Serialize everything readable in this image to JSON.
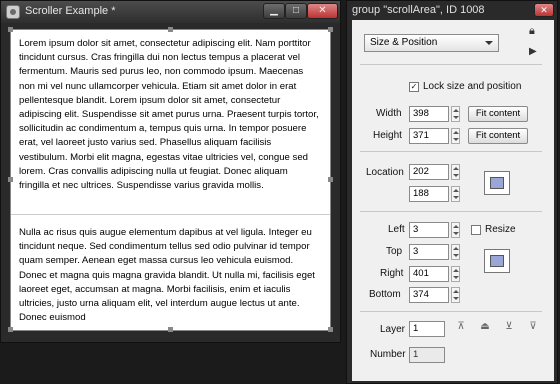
{
  "scroller_window": {
    "title": "Scroller Example *",
    "controls": {
      "minimize": "▁",
      "maximize": "□",
      "close": "✕"
    },
    "paragraph_1": "Lorem ipsum dolor sit amet, consectetur adipiscing elit. Nam porttitor tincidunt cursus. Cras fringilla dui non lectus tempus a placerat vel fermentum. Mauris sed purus leo, non commodo ipsum. Maecenas non mi vel nunc ullamcorper vehicula. Etiam sit amet dolor in erat pellentesque blandit. Lorem ipsum dolor sit amet, consectetur adipiscing elit. Suspendisse sit amet purus urna. Praesent turpis tortor, sollicitudin ac condimentum a, tempus quis urna. In tempor posuere erat, vel laoreet justo varius sed. Phasellus aliquam facilisis vestibulum. Morbi elit magna, egestas vitae ultricies vel, congue sed lorem. Cras convallis adipiscing nulla ut feugiat. Donec aliquam fringilla et nec ultrices. Suspendisse varius gravida mollis.",
    "paragraph_2": "Nulla ac risus quis augue elementum dapibus at vel ligula. Integer eu tincidunt neque. Sed condimentum tellus sed odio pulvinar id tempor quam semper. Aenean eget massa cursus leo vehicula euismod. Donec et magna quis magna gravida blandit. Ut nulla mi, facilisis eget laoreet eget, accumsan at magna. Morbi facilisis, enim et iaculis ultricies, justo urna aliquam elit, vel interdum augue lectus ut ante. Donec euismod"
  },
  "inspector": {
    "title": "group \"scrollArea\", ID 1008",
    "close": "✕",
    "section_select": "Size & Position",
    "lock_checkbox": {
      "label": "Lock size and position",
      "checked": true,
      "mark": "✓"
    },
    "width": {
      "label": "Width",
      "value": "398"
    },
    "height": {
      "label": "Height",
      "value": "371"
    },
    "fit_content_label": "Fit content",
    "location": {
      "label": "Location",
      "x": "202",
      "y": "188"
    },
    "left": {
      "label": "Left",
      "value": "3"
    },
    "top": {
      "label": "Top",
      "value": "3"
    },
    "right": {
      "label": "Right",
      "value": "401"
    },
    "bottom": {
      "label": "Bottom",
      "value": "374"
    },
    "resize_checkbox": {
      "label": "Resize",
      "checked": false
    },
    "layer": {
      "label": "Layer",
      "value": "1"
    },
    "number": {
      "label": "Number",
      "value": "1"
    },
    "icons": {
      "lock": "lock-icon",
      "play": "play-icon"
    }
  }
}
